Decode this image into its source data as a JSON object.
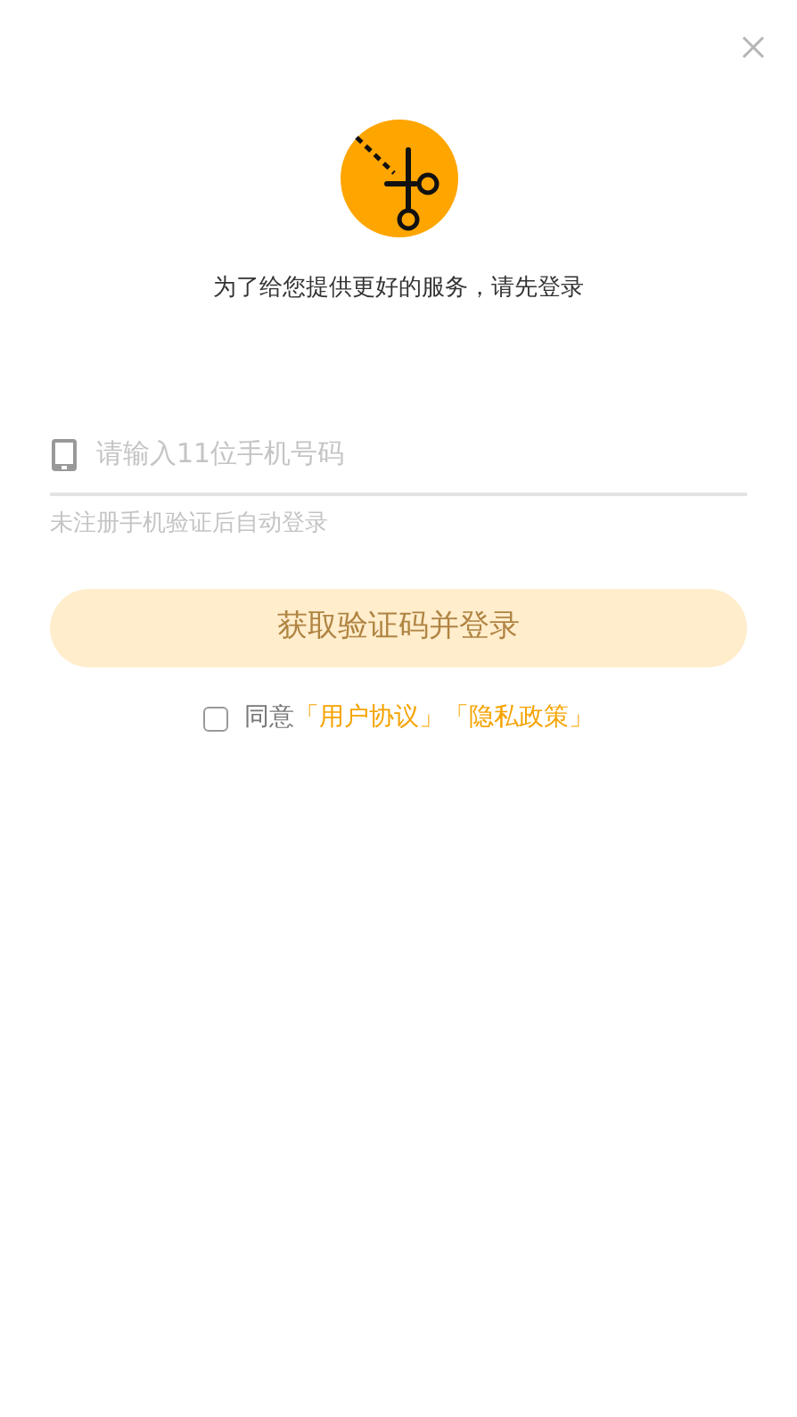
{
  "subtitle": "为了给您提供更好的服务，请先登录",
  "phone_field": {
    "placeholder": "请输入11位手机号码"
  },
  "hint": "未注册手机验证后自动登录",
  "login_button": {
    "label": "获取验证码并登录",
    "disabled": true
  },
  "agreement": {
    "checked": false,
    "text": "同意",
    "links": [
      "「用户协议」",
      "「隐私政策」"
    ]
  }
}
